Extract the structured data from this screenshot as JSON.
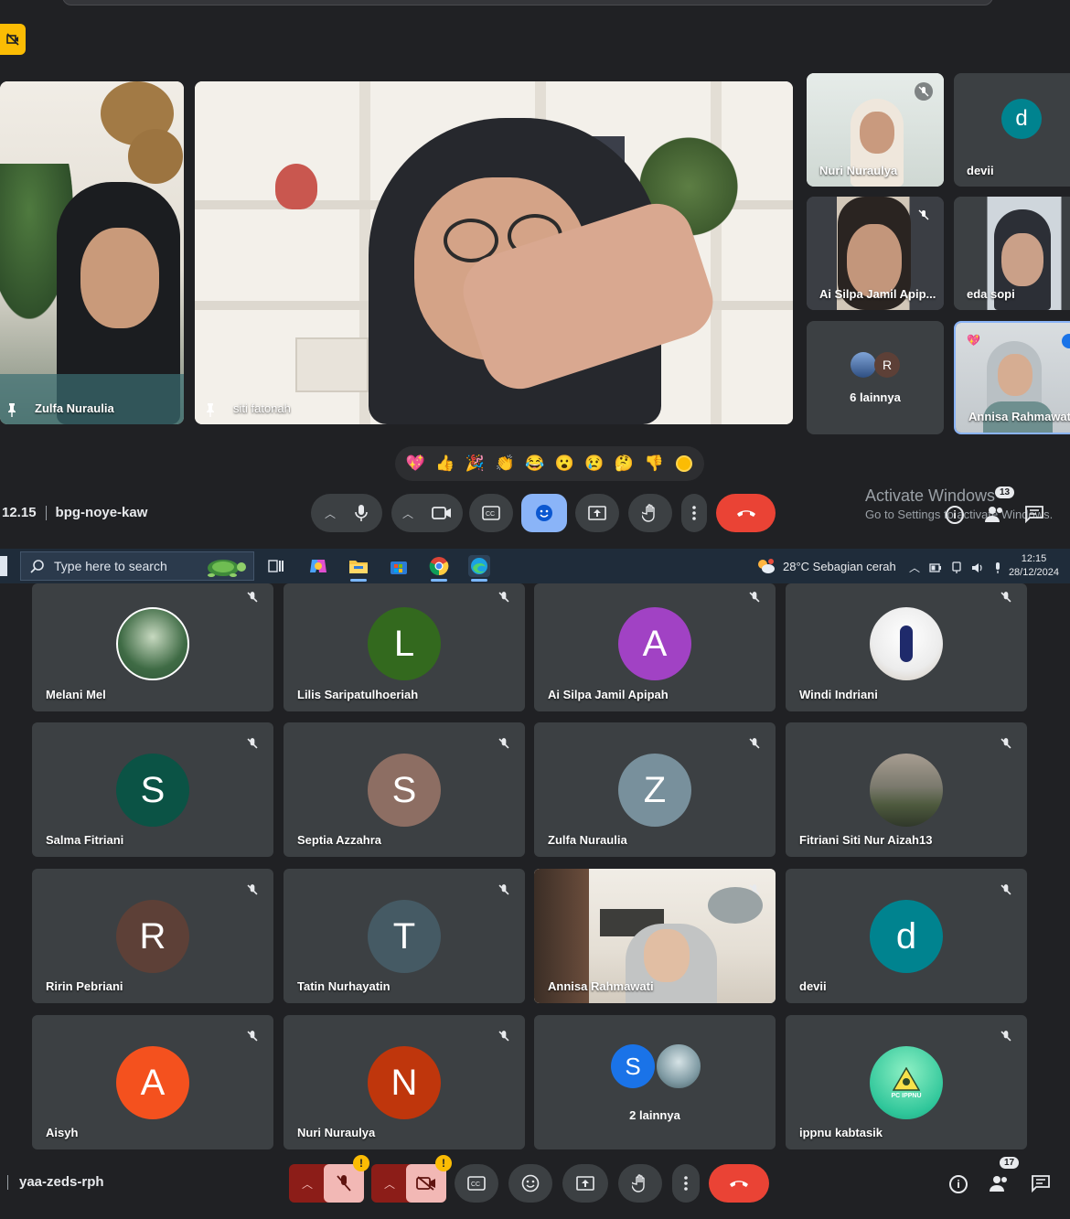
{
  "top_meeting": {
    "code": "bpg-noye-kaw",
    "time": "12.15",
    "main_tiles": [
      {
        "name": "Zulfa Nuraulia"
      },
      {
        "name": "siti fatonah"
      }
    ],
    "side_tiles": [
      {
        "name": "Nuri Nuraulya"
      },
      {
        "name": "devii",
        "initial": "d"
      },
      {
        "name": "Ai Silpa Jamil Apip..."
      },
      {
        "name": "eda sopi"
      },
      {
        "name": "6 lainnya",
        "initial": "R"
      },
      {
        "name": "Annisa Rahmawati"
      }
    ],
    "reactions": [
      "💖",
      "👍",
      "🎉",
      "👏",
      "😂",
      "😮",
      "😢",
      "🤔",
      "👎"
    ],
    "people_badge": "13"
  },
  "windows_watermark": {
    "line1": "Activate Windows",
    "line2": "Go to Settings to activate Windows."
  },
  "taskbar": {
    "search_placeholder": "Type here to search",
    "weather": "28°C  Sebagian cerah",
    "time": "12:15",
    "date": "28/12/2024"
  },
  "bottom_meeting": {
    "code": "yaa-zeds-rph",
    "people_badge": "17",
    "tiles": [
      {
        "name": "Melani Mel",
        "type": "photo"
      },
      {
        "name": "Lilis Saripatulhoeriah",
        "initial": "L",
        "color": "#33691e"
      },
      {
        "name": "Ai Silpa Jamil Apipah",
        "initial": "A",
        "color": "#a142c4"
      },
      {
        "name": "Windi Indriani",
        "type": "photo"
      },
      {
        "name": "Salma Fitriani",
        "initial": "S",
        "color": "#0b5345"
      },
      {
        "name": "Septia Azzahra",
        "initial": "S",
        "color": "#8d6e63"
      },
      {
        "name": "Zulfa Nuraulia",
        "initial": "Z",
        "color": "#78909c"
      },
      {
        "name": "Fitriani Siti Nur Aizah13",
        "type": "photo"
      },
      {
        "name": "Ririn Pebriani",
        "initial": "R",
        "color": "#5d4037"
      },
      {
        "name": "Tatin Nurhayatin",
        "initial": "T",
        "color": "#455a64"
      },
      {
        "name": "Annisa Rahmawati",
        "type": "video"
      },
      {
        "name": "devii",
        "initial": "d",
        "color": "#00838f"
      },
      {
        "name": "Aisyh",
        "initial": "A",
        "color": "#f4511e"
      },
      {
        "name": "Nuri Nuraulya",
        "initial": "N",
        "color": "#bf360c"
      },
      {
        "name": "2 lainnya",
        "initial": "S",
        "color": "#1a73e8"
      },
      {
        "name": "ippnu kabtasik",
        "type": "logo",
        "logo_text": "PC IPPNU"
      }
    ]
  },
  "colors": {
    "background": "#202124",
    "tile": "#3c4043",
    "hangup": "#ea4335",
    "active_reaction_button": "#8ab4f8",
    "muted_control": "#8c1d18"
  }
}
